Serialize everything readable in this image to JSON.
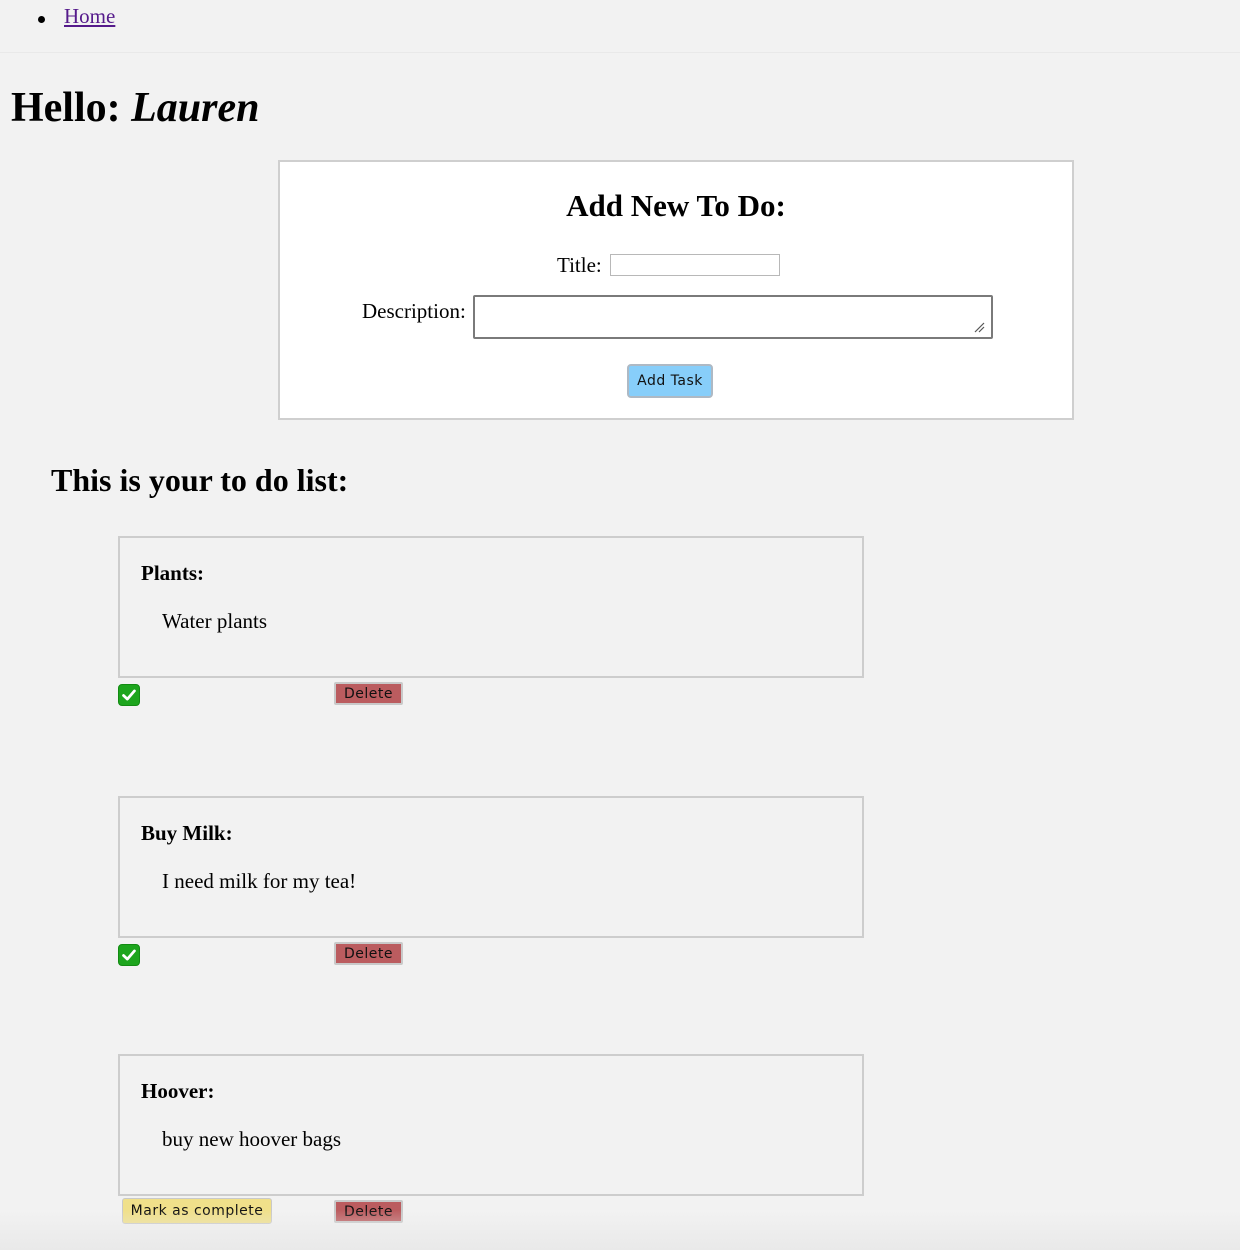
{
  "nav": {
    "items": [
      {
        "label": "Home"
      }
    ]
  },
  "greeting": {
    "prefix": "Hello: ",
    "name": "Lauren"
  },
  "form": {
    "heading": "Add New To Do:",
    "title_label": "Title:",
    "title_value": "",
    "description_label": "Description:",
    "description_value": "",
    "submit_label": "Add Task"
  },
  "list": {
    "heading": "This is your to do list:",
    "items": [
      {
        "title": "Plants:",
        "description": "Water plants",
        "completed": true,
        "delete_label": "Delete"
      },
      {
        "title": "Buy Milk:",
        "description": "I need milk for my tea!",
        "completed": true,
        "delete_label": "Delete"
      },
      {
        "title": "Hoover:",
        "description": "buy new hoover bags",
        "completed": false,
        "complete_label": "Mark as complete",
        "delete_label": "Delete"
      }
    ]
  },
  "colors": {
    "page_bg": "#f2f2f2",
    "link": "#551a8b",
    "add_button": "#87cefa",
    "complete_button": "#f0e08a",
    "delete_button": "#bb5c5f",
    "check": "#1da51d"
  },
  "icons": {
    "completed": "check-mark-button-icon",
    "resize": "resize-grip-icon"
  }
}
